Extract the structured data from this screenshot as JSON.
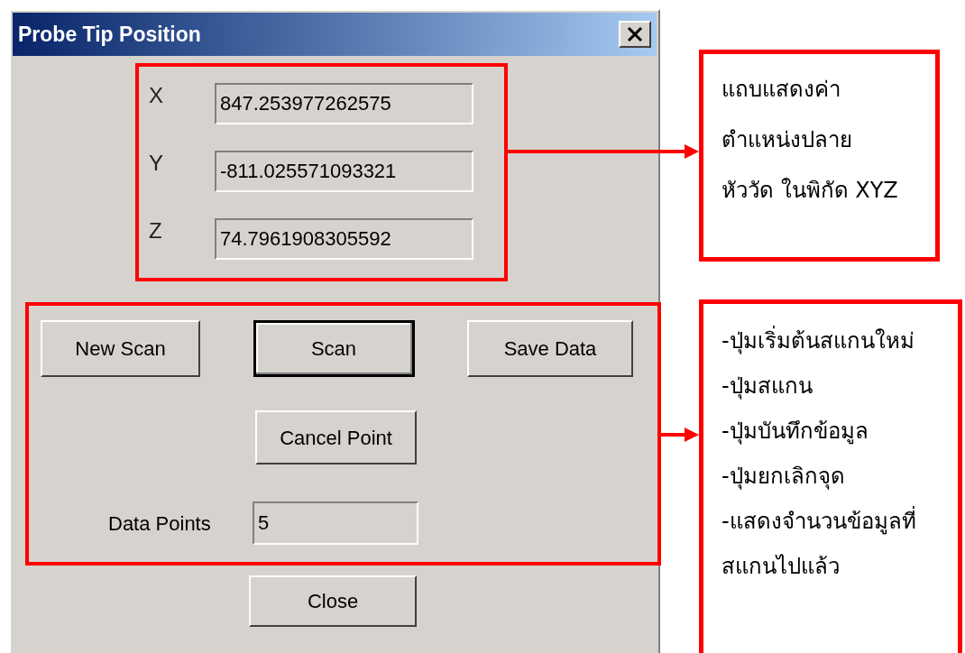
{
  "window": {
    "title": "Probe Tip Position"
  },
  "coordinates": [
    {
      "label": "X",
      "value": "847.253977262575"
    },
    {
      "label": "Y",
      "value": "-811.025571093321"
    },
    {
      "label": "Z",
      "value": "74.7961908305592"
    }
  ],
  "buttons": [
    {
      "label": "New Scan",
      "default": false
    },
    {
      "label": "Scan",
      "default": true
    },
    {
      "label": "Save Data",
      "default": false
    }
  ],
  "cancel_button": {
    "label": "Cancel Point"
  },
  "data_points": {
    "label": "Data Points",
    "value": "5"
  },
  "close_button": {
    "label": "Close"
  },
  "annotations": [
    {
      "lines": [
        "แถบแสดงค่า",
        "ตำแหน่งปลาย",
        "หัววัด ในพิกัด XYZ"
      ]
    },
    {
      "lines": [
        "-ปุ่มเริ่มต้นสแกนใหม่",
        "-ปุ่มสแกน",
        "-ปุ่มบันทึกข้อมูล",
        "-ปุ่มยกเลิกจุด",
        "-แสดงจำนวนข้อมูลที่",
        "สแกนไปแล้ว"
      ]
    }
  ]
}
